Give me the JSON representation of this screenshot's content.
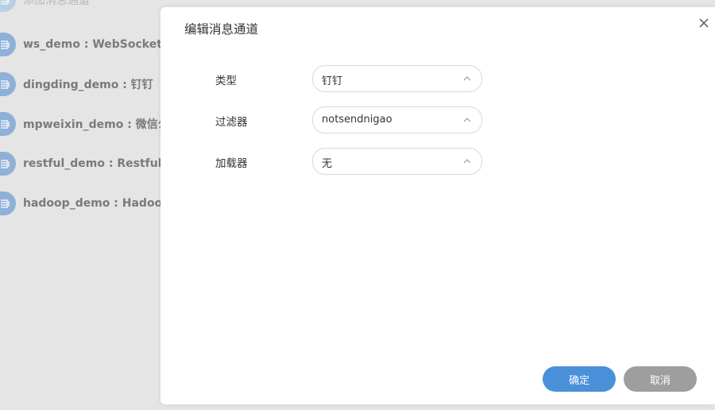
{
  "background": {
    "top_item": {
      "label": "添加消息通道",
      "icon": "channel-icon"
    },
    "channels": [
      {
        "label": "ws_demo : WebSocket",
        "icon": "channel-icon"
      },
      {
        "label": "dingding_demo : 钉钉",
        "icon": "channel-icon"
      },
      {
        "label": "mpweixin_demo : 微信公众号",
        "icon": "channel-icon"
      },
      {
        "label": "restful_demo : Restful",
        "icon": "channel-icon"
      },
      {
        "label": "hadoop_demo : Hadoop",
        "icon": "channel-icon"
      }
    ]
  },
  "modal": {
    "title": "编辑消息通道",
    "close_icon": "close-icon",
    "fields": [
      {
        "label": "类型",
        "value": "钉钉"
      },
      {
        "label": "过滤器",
        "value": "notsendnigao"
      },
      {
        "label": "加载器",
        "value": "无"
      }
    ],
    "ok_label": "确定",
    "cancel_label": "取消"
  },
  "colors": {
    "primary": "#4a90d9",
    "cancel": "#9e9e9e",
    "overlay": "#e5e5e5",
    "icon": "#8fb0d7"
  }
}
